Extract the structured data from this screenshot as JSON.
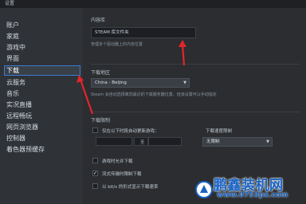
{
  "window": {
    "title": "设置"
  },
  "sidebar": {
    "items": [
      {
        "label": "账户"
      },
      {
        "label": "家庭"
      },
      {
        "label": "游戏中"
      },
      {
        "label": "界面"
      },
      {
        "label": "下载",
        "active": true
      },
      {
        "label": "云服务"
      },
      {
        "label": "音乐"
      },
      {
        "label": "实况直播"
      },
      {
        "label": "远程畅玩"
      },
      {
        "label": "网页浏览器"
      },
      {
        "label": "控制器"
      },
      {
        "label": "着色器预缓存"
      }
    ]
  },
  "content_library": {
    "title": "内容库",
    "folders_button": "STEAM 库文件夹",
    "hint": "管理多个驱动器上的内容位置"
  },
  "download_region": {
    "title": "下载地区",
    "selected": "China - Beijing",
    "hint": "Steam 会自动选择离您最近的下载服务器位置，但该设置可以手动指定"
  },
  "download_limits": {
    "title": "下载限制",
    "time_checkbox": {
      "label": "仅在以下时段自动更新游戏：",
      "checked": false
    },
    "time_separator": "至",
    "bandwidth_label": "下载速度限制",
    "bandwidth_value": "无限制",
    "allow_while_playing": {
      "label": "游戏时允许下载",
      "checked": false
    },
    "throttle_streaming": {
      "label": "流式传输时限制下载",
      "checked": true
    },
    "show_bits": {
      "label": "以 bit/s 的形式显示下载速率",
      "checked": false
    }
  },
  "watermark": {
    "brand": "鹏鑫装机网",
    "url": "www.0753px.com"
  },
  "colors": {
    "accent_blue": "#3d7bd6",
    "arrow_red": "#e0262b",
    "watermark_blue": "#1a63c2"
  }
}
